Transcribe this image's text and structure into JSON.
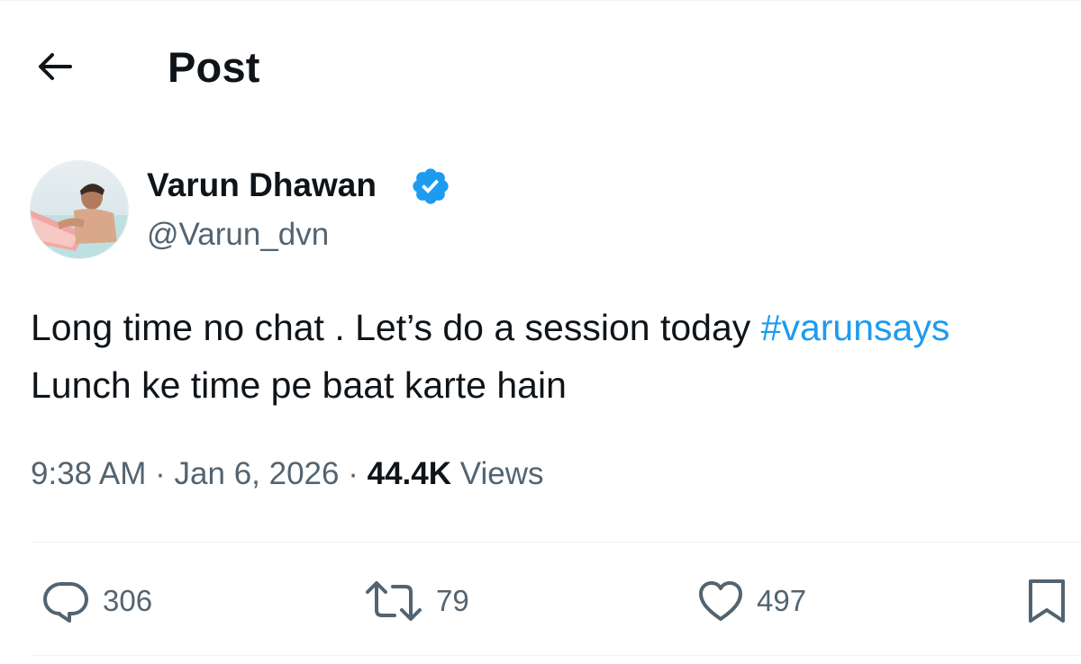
{
  "header": {
    "title": "Post",
    "back_icon": "arrow-left-icon"
  },
  "author": {
    "name": "Varun Dhawan",
    "handle": "@Varun_dvn",
    "verified_icon": "verified-badge-icon",
    "verified_color": "#1d9bf0",
    "avatar_icon": "avatar-photo"
  },
  "post": {
    "text_line1": "Long time no chat . Let’s do a session today ",
    "hashtag": "#varunsays",
    "text_line2": "Lunch ke time pe baat karte hain",
    "time": "9:38 AM",
    "sep1": "·",
    "date": "Jan 6, 2026",
    "sep2": "·",
    "views_count": "44.4K",
    "views_label": "Views"
  },
  "actions": {
    "reply": {
      "icon": "reply-icon",
      "count": "306"
    },
    "repost": {
      "icon": "repost-icon",
      "count": "79"
    },
    "like": {
      "icon": "heart-icon",
      "count": "497"
    },
    "bookmark": {
      "icon": "bookmark-icon"
    }
  },
  "colors": {
    "text": "#0f1419",
    "secondary": "#536471",
    "link": "#1d9bf0",
    "border": "#eff3f4"
  }
}
